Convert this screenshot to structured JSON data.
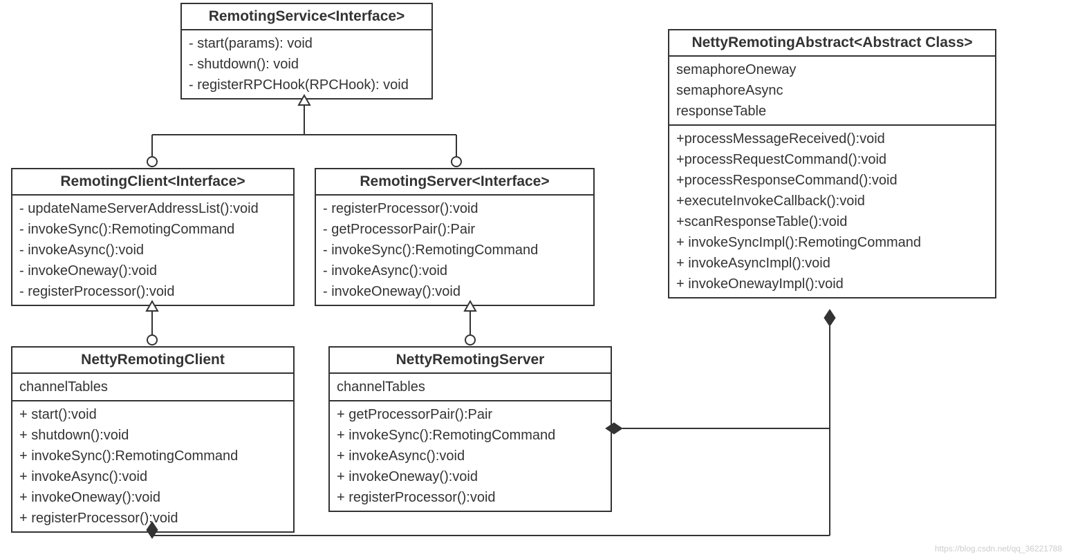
{
  "classes": {
    "remotingService": {
      "title": "RemotingService<Interface>",
      "methods": [
        "- start(params): void",
        "- shutdown(): void",
        "- registerRPCHook(RPCHook): void"
      ]
    },
    "remotingClient": {
      "title": "RemotingClient<Interface>",
      "methods": [
        "- updateNameServerAddressList():void",
        "- invokeSync():RemotingCommand",
        "- invokeAsync():void",
        "- invokeOneway():void",
        "- registerProcessor():void"
      ]
    },
    "remotingServer": {
      "title": "RemotingServer<Interface>",
      "methods": [
        "- registerProcessor():void",
        "- getProcessorPair():Pair",
        "- invokeSync():RemotingCommand",
        "- invokeAsync():void",
        "- invokeOneway():void"
      ]
    },
    "nettyRemotingClient": {
      "title": "NettyRemotingClient",
      "attrs": [
        "channelTables"
      ],
      "methods": [
        "+ start():void",
        "+ shutdown():void",
        "+ invokeSync():RemotingCommand",
        "+ invokeAsync():void",
        "+ invokeOneway():void",
        "+ registerProcessor():void"
      ]
    },
    "nettyRemotingServer": {
      "title": "NettyRemotingServer",
      "attrs": [
        "channelTables"
      ],
      "methods": [
        "+ getProcessorPair():Pair",
        "+ invokeSync():RemotingCommand",
        "+ invokeAsync():void",
        "+ invokeOneway():void",
        "+ registerProcessor():void"
      ]
    },
    "nettyRemotingAbstract": {
      "title": "NettyRemotingAbstract<Abstract Class>",
      "attrs": [
        "semaphoreOneway",
        "semaphoreAsync",
        "responseTable"
      ],
      "methods": [
        "+processMessageReceived():void",
        "+processRequestCommand():void",
        "+processResponseCommand():void",
        "+executeInvokeCallback():void",
        "+scanResponseTable():void",
        "+ invokeSyncImpl():RemotingCommand",
        "+ invokeAsyncImpl():void",
        "+ invokeOnewayImpl():void"
      ]
    }
  },
  "watermark": "https://blog.csdn.net/qq_36221788"
}
